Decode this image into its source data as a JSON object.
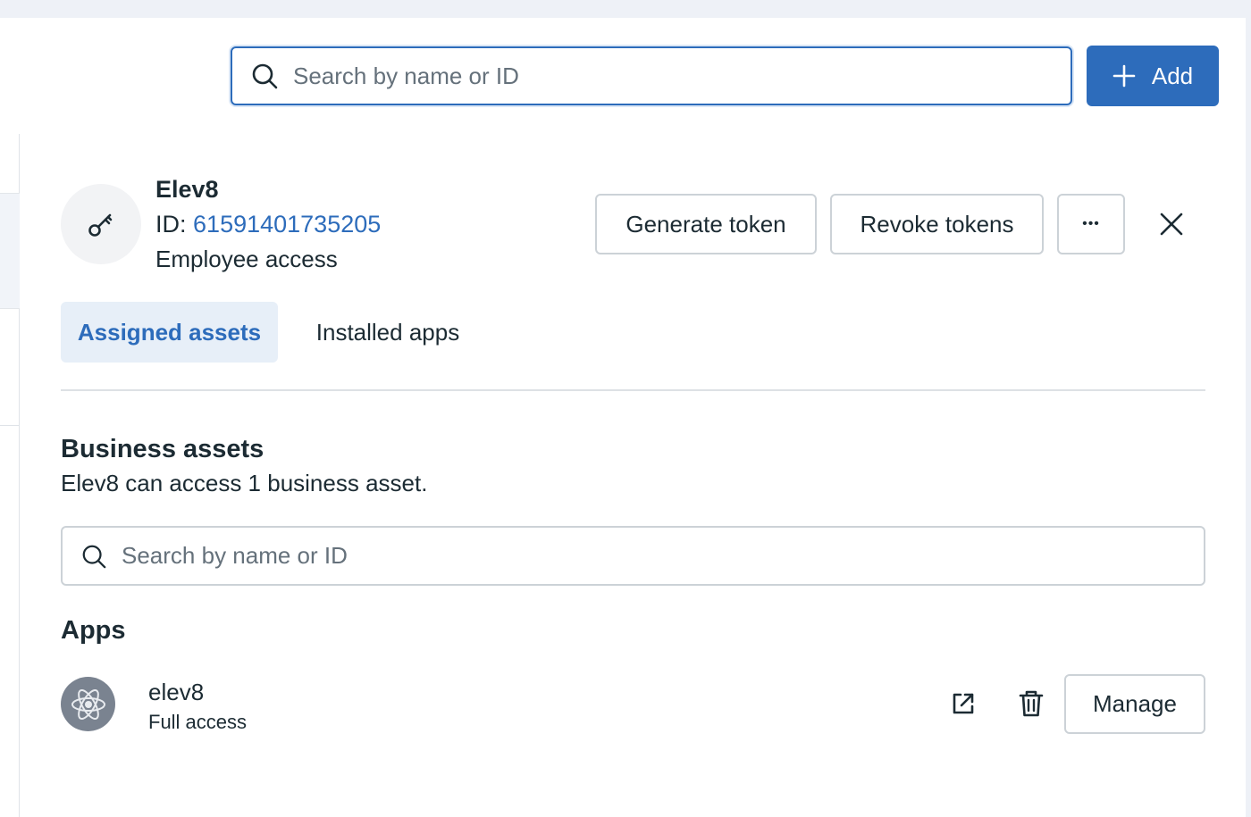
{
  "header": {
    "search_placeholder": "Search by name or ID",
    "add_label": "Add"
  },
  "entity": {
    "name": "Elev8",
    "id_label": "ID:",
    "id_value": "61591401735205",
    "access": "Employee access",
    "actions": {
      "generate_token": "Generate token",
      "revoke_tokens": "Revoke tokens",
      "more": "•••"
    }
  },
  "tabs": [
    {
      "label": "Assigned assets",
      "active": true
    },
    {
      "label": "Installed apps",
      "active": false
    }
  ],
  "business_assets": {
    "title": "Business assets",
    "description": "Elev8 can access 1 business asset.",
    "search_placeholder": "Search by name or ID"
  },
  "apps": {
    "title": "Apps",
    "items": [
      {
        "name": "elev8",
        "access": "Full access",
        "manage_label": "Manage"
      }
    ]
  },
  "colors": {
    "accent": "#2d6cbb",
    "tab_active_bg": "#e7eff8",
    "text": "#1c2b33",
    "border": "#ccd2d7"
  },
  "icons": {
    "search": "search-icon",
    "add": "plus-icon",
    "key": "key-icon",
    "close": "close-icon",
    "app": "atom-icon",
    "external": "external-link-icon",
    "delete": "trash-icon"
  }
}
